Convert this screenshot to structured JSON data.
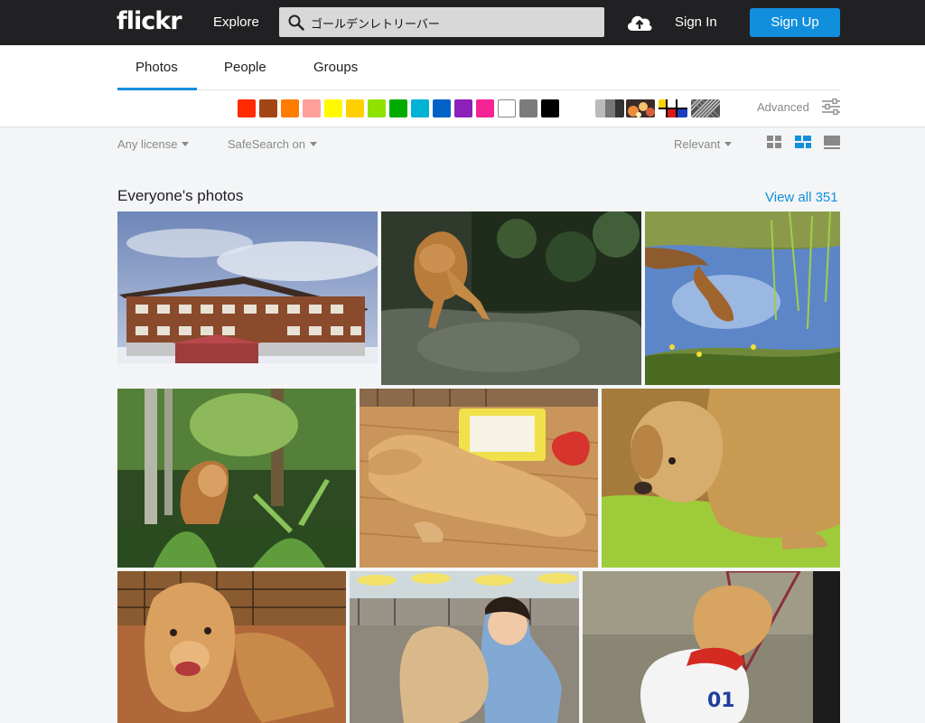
{
  "topbar": {
    "logo": "flickr",
    "explore": "Explore",
    "search_value": "ゴールデンレトリーバー",
    "sign_in": "Sign In",
    "sign_up": "Sign Up",
    "icons": [
      "search-icon",
      "upload-cloud-icon"
    ]
  },
  "tabs": [
    {
      "label": "Photos",
      "active": true
    },
    {
      "label": "People",
      "active": false
    },
    {
      "label": "Groups",
      "active": false
    }
  ],
  "color_filters": [
    "#ff2a00",
    "#a24615",
    "#ff7c00",
    "#ff9f9c",
    "#fffa00",
    "#ffcf00",
    "#90e200",
    "#00ab00",
    "#00b2d4",
    "#0062c6",
    "#8c20ba",
    "#f52394",
    "#ffffff",
    "#7b7b7b",
    "#000000"
  ],
  "style_filters": [
    "black-and-white",
    "shallow-depth-of-field",
    "minimalist",
    "patterns"
  ],
  "advanced": "Advanced",
  "filters": {
    "license": "Any license",
    "safesearch": "SafeSearch on",
    "sort": "Relevant"
  },
  "view_modes": [
    "grid-small-icon",
    "grid-justified-icon",
    "grid-large-icon"
  ],
  "active_view": "grid-justified-icon",
  "section": {
    "title": "Everyone's photos",
    "view_all": "View all 351"
  },
  "photos": [
    {
      "subject": "mountain lodge in snow"
    },
    {
      "subject": "dog on path"
    },
    {
      "subject": "dog reflection in pond"
    },
    {
      "subject": "golden retriever in forest"
    },
    {
      "subject": "golden retriever lying on floor"
    },
    {
      "subject": "golden retriever close-up"
    },
    {
      "subject": "golden retriever indoors"
    },
    {
      "subject": "woman hugging golden retriever"
    },
    {
      "subject": "golden retriever in shirt"
    }
  ],
  "colors": {
    "accent": "#128fdc",
    "topbar": "#212124"
  }
}
